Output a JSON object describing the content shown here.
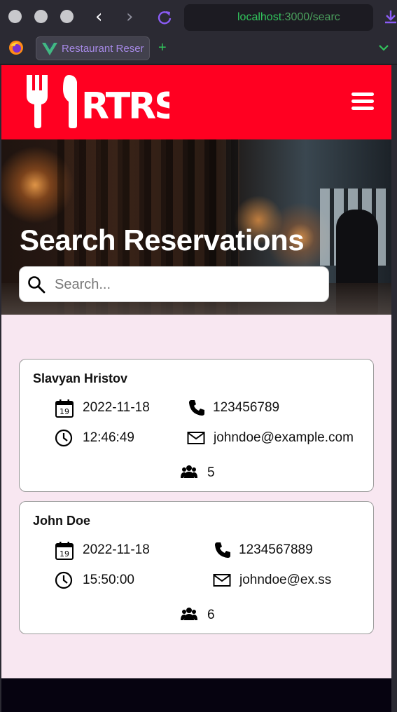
{
  "browser": {
    "url_host": "localhost",
    "url_rest": ":3000/searc",
    "tab_title": "Restaurant Reser",
    "new_tab": "+"
  },
  "header": {
    "logo_text": "RTRS",
    "menu_icon": "hamburger-menu-icon"
  },
  "hero": {
    "title": "Search Reservations",
    "search_placeholder": "Search..."
  },
  "reservations": [
    {
      "name": "Slavyan Hristov",
      "date": "2022-11-18",
      "time": "12:46:49",
      "phone": "123456789",
      "email": "johndoe@example.com",
      "guests": "5",
      "calendar_day": "19"
    },
    {
      "name": "John Doe",
      "date": "2022-11-18",
      "time": "15:50:00",
      "phone": "1234567889",
      "email": "johndoe@ex.ss",
      "guests": "6",
      "calendar_day": "19"
    }
  ],
  "colors": {
    "brand_red": "#ff0021",
    "page_bg": "#f8e7f1",
    "url_green": "#31c45c"
  }
}
